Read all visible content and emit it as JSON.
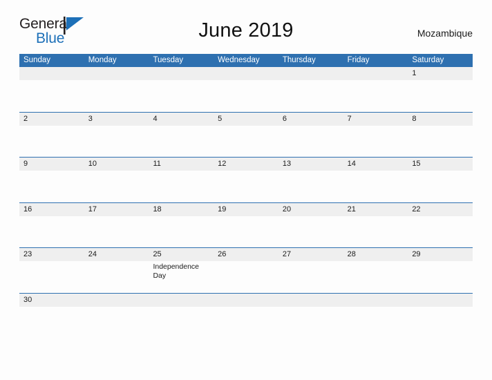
{
  "brand": {
    "name_part1": "General",
    "name_part2": "Blue",
    "mark_icon": "pennant-flag-icon",
    "accent_color": "#1d70b8"
  },
  "header": {
    "title": "June 2019",
    "region": "Mozambique"
  },
  "colors": {
    "header_blue": "#2e70b0",
    "date_band_gray": "#efefef",
    "page_background": "#fdfdfd",
    "text": "#1a1a1a"
  },
  "calendar": {
    "month": "June",
    "year": "2019",
    "weekday_headers": [
      "Sunday",
      "Monday",
      "Tuesday",
      "Wednesday",
      "Thursday",
      "Friday",
      "Saturday"
    ],
    "weeks": [
      {
        "days": [
          {
            "date": "",
            "events": []
          },
          {
            "date": "",
            "events": []
          },
          {
            "date": "",
            "events": []
          },
          {
            "date": "",
            "events": []
          },
          {
            "date": "",
            "events": []
          },
          {
            "date": "",
            "events": []
          },
          {
            "date": "1",
            "events": []
          }
        ]
      },
      {
        "days": [
          {
            "date": "2",
            "events": []
          },
          {
            "date": "3",
            "events": []
          },
          {
            "date": "4",
            "events": []
          },
          {
            "date": "5",
            "events": []
          },
          {
            "date": "6",
            "events": []
          },
          {
            "date": "7",
            "events": []
          },
          {
            "date": "8",
            "events": []
          }
        ]
      },
      {
        "days": [
          {
            "date": "9",
            "events": []
          },
          {
            "date": "10",
            "events": []
          },
          {
            "date": "11",
            "events": []
          },
          {
            "date": "12",
            "events": []
          },
          {
            "date": "13",
            "events": []
          },
          {
            "date": "14",
            "events": []
          },
          {
            "date": "15",
            "events": []
          }
        ]
      },
      {
        "days": [
          {
            "date": "16",
            "events": []
          },
          {
            "date": "17",
            "events": []
          },
          {
            "date": "18",
            "events": []
          },
          {
            "date": "19",
            "events": []
          },
          {
            "date": "20",
            "events": []
          },
          {
            "date": "21",
            "events": []
          },
          {
            "date": "22",
            "events": []
          }
        ]
      },
      {
        "days": [
          {
            "date": "23",
            "events": []
          },
          {
            "date": "24",
            "events": []
          },
          {
            "date": "25",
            "events": [
              "Independence Day"
            ]
          },
          {
            "date": "26",
            "events": []
          },
          {
            "date": "27",
            "events": []
          },
          {
            "date": "28",
            "events": []
          },
          {
            "date": "29",
            "events": []
          }
        ]
      },
      {
        "last": true,
        "days": [
          {
            "date": "30",
            "events": []
          },
          {
            "date": "",
            "events": []
          },
          {
            "date": "",
            "events": []
          },
          {
            "date": "",
            "events": []
          },
          {
            "date": "",
            "events": []
          },
          {
            "date": "",
            "events": []
          },
          {
            "date": "",
            "events": []
          }
        ]
      }
    ]
  }
}
